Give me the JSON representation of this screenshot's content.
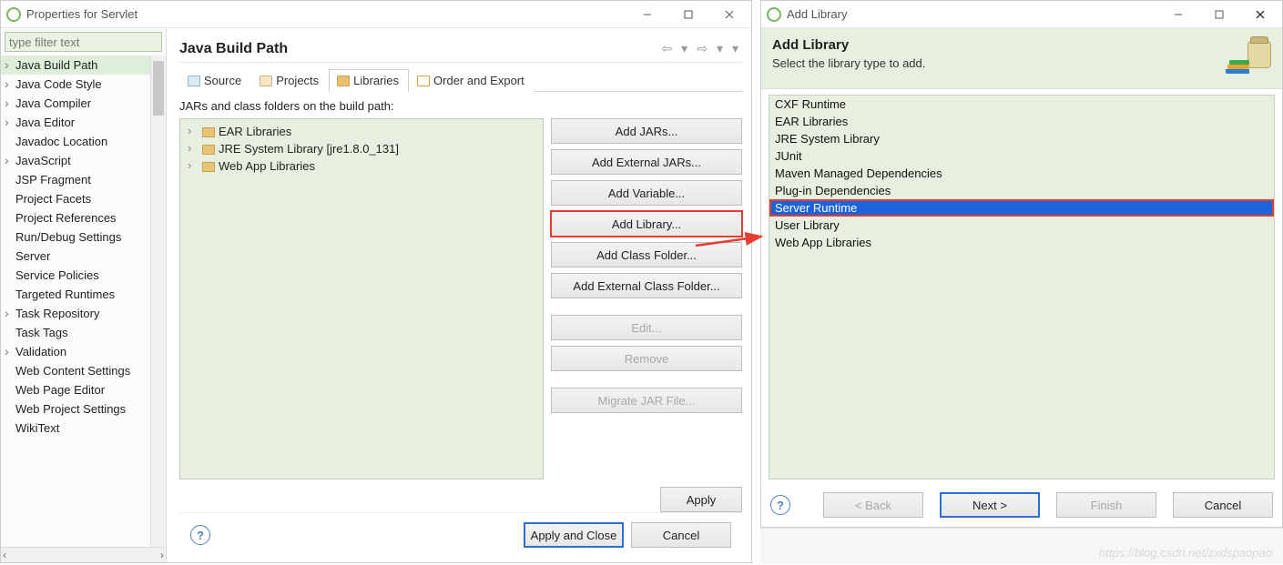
{
  "win1": {
    "title": "Properties for Servlet",
    "filter_placeholder": "type filter text",
    "categories": [
      {
        "label": "Java Build Path",
        "exp": true,
        "selected": true
      },
      {
        "label": "Java Code Style",
        "exp": true
      },
      {
        "label": "Java Compiler",
        "exp": true
      },
      {
        "label": "Java Editor",
        "exp": true
      },
      {
        "label": "Javadoc Location"
      },
      {
        "label": "JavaScript",
        "exp": true
      },
      {
        "label": "JSP Fragment"
      },
      {
        "label": "Project Facets"
      },
      {
        "label": "Project References"
      },
      {
        "label": "Run/Debug Settings"
      },
      {
        "label": "Server"
      },
      {
        "label": "Service Policies"
      },
      {
        "label": "Targeted Runtimes"
      },
      {
        "label": "Task Repository",
        "exp": true
      },
      {
        "label": "Task Tags"
      },
      {
        "label": "Validation",
        "exp": true
      },
      {
        "label": "Web Content Settings"
      },
      {
        "label": "Web Page Editor"
      },
      {
        "label": "Web Project Settings"
      },
      {
        "label": "WikiText"
      }
    ],
    "heading": "Java Build Path",
    "tabs": [
      {
        "label": "Source",
        "icon": "src"
      },
      {
        "label": "Projects",
        "icon": "prj"
      },
      {
        "label": "Libraries",
        "icon": "lib",
        "active": true
      },
      {
        "label": "Order and Export",
        "icon": "ord"
      }
    ],
    "tree_label": "JARs and class folders on the build path:",
    "tree": [
      {
        "label": "EAR Libraries"
      },
      {
        "label": "JRE System Library [jre1.8.0_131]"
      },
      {
        "label": "Web App Libraries"
      }
    ],
    "buttons": [
      {
        "label": "Add JARs...",
        "name": "add-jars-button"
      },
      {
        "label": "Add External JARs...",
        "name": "add-external-jars-button"
      },
      {
        "label": "Add Variable...",
        "name": "add-variable-button"
      },
      {
        "label": "Add Library...",
        "name": "add-library-button",
        "highlight": true
      },
      {
        "label": "Add Class Folder...",
        "name": "add-class-folder-button"
      },
      {
        "label": "Add External Class Folder...",
        "name": "add-external-class-folder-button"
      },
      {
        "label": "Edit...",
        "name": "edit-button",
        "disabled": true,
        "gap": true
      },
      {
        "label": "Remove",
        "name": "remove-button",
        "disabled": true
      },
      {
        "label": "Migrate JAR File...",
        "name": "migrate-jar-button",
        "disabled": true,
        "gap": true
      }
    ],
    "apply": "Apply",
    "apply_close": "Apply and Close",
    "cancel": "Cancel"
  },
  "win2": {
    "title": "Add Library",
    "banner_title": "Add Library",
    "banner_sub": "Select the library type to add.",
    "items": [
      {
        "label": "CXF Runtime"
      },
      {
        "label": "EAR Libraries"
      },
      {
        "label": "JRE System Library"
      },
      {
        "label": "JUnit"
      },
      {
        "label": "Maven Managed Dependencies"
      },
      {
        "label": "Plug-in Dependencies"
      },
      {
        "label": "Server Runtime",
        "selected": true
      },
      {
        "label": "User Library"
      },
      {
        "label": "Web App Libraries"
      }
    ],
    "back": "< Back",
    "next": "Next >",
    "finish": "Finish",
    "cancel": "Cancel"
  },
  "watermark": "https://blog.csdn.net/zxdspaopao"
}
